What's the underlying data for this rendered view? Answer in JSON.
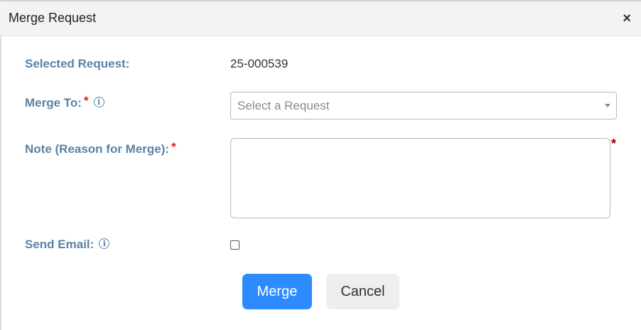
{
  "dialog": {
    "title": "Merge Request",
    "close_symbol": "×"
  },
  "fields": {
    "selected_request": {
      "label": "Selected Request:",
      "value": "25-000539"
    },
    "merge_to": {
      "label": "Merge To:",
      "required_mark": "*",
      "info_icon": "i",
      "placeholder": "Select a Request"
    },
    "note": {
      "label": "Note (Reason for Merge):",
      "required_mark": "*",
      "side_mark": "*",
      "value": ""
    },
    "send_email": {
      "label": "Send Email:",
      "info_icon": "i",
      "checked": false
    }
  },
  "buttons": {
    "merge": "Merge",
    "cancel": "Cancel"
  },
  "colors": {
    "label": "#5b82a6",
    "required": "#e01b1b",
    "primary": "#2e8bff",
    "secondary": "#eeeeee",
    "header_bg": "#f3f3f3"
  }
}
